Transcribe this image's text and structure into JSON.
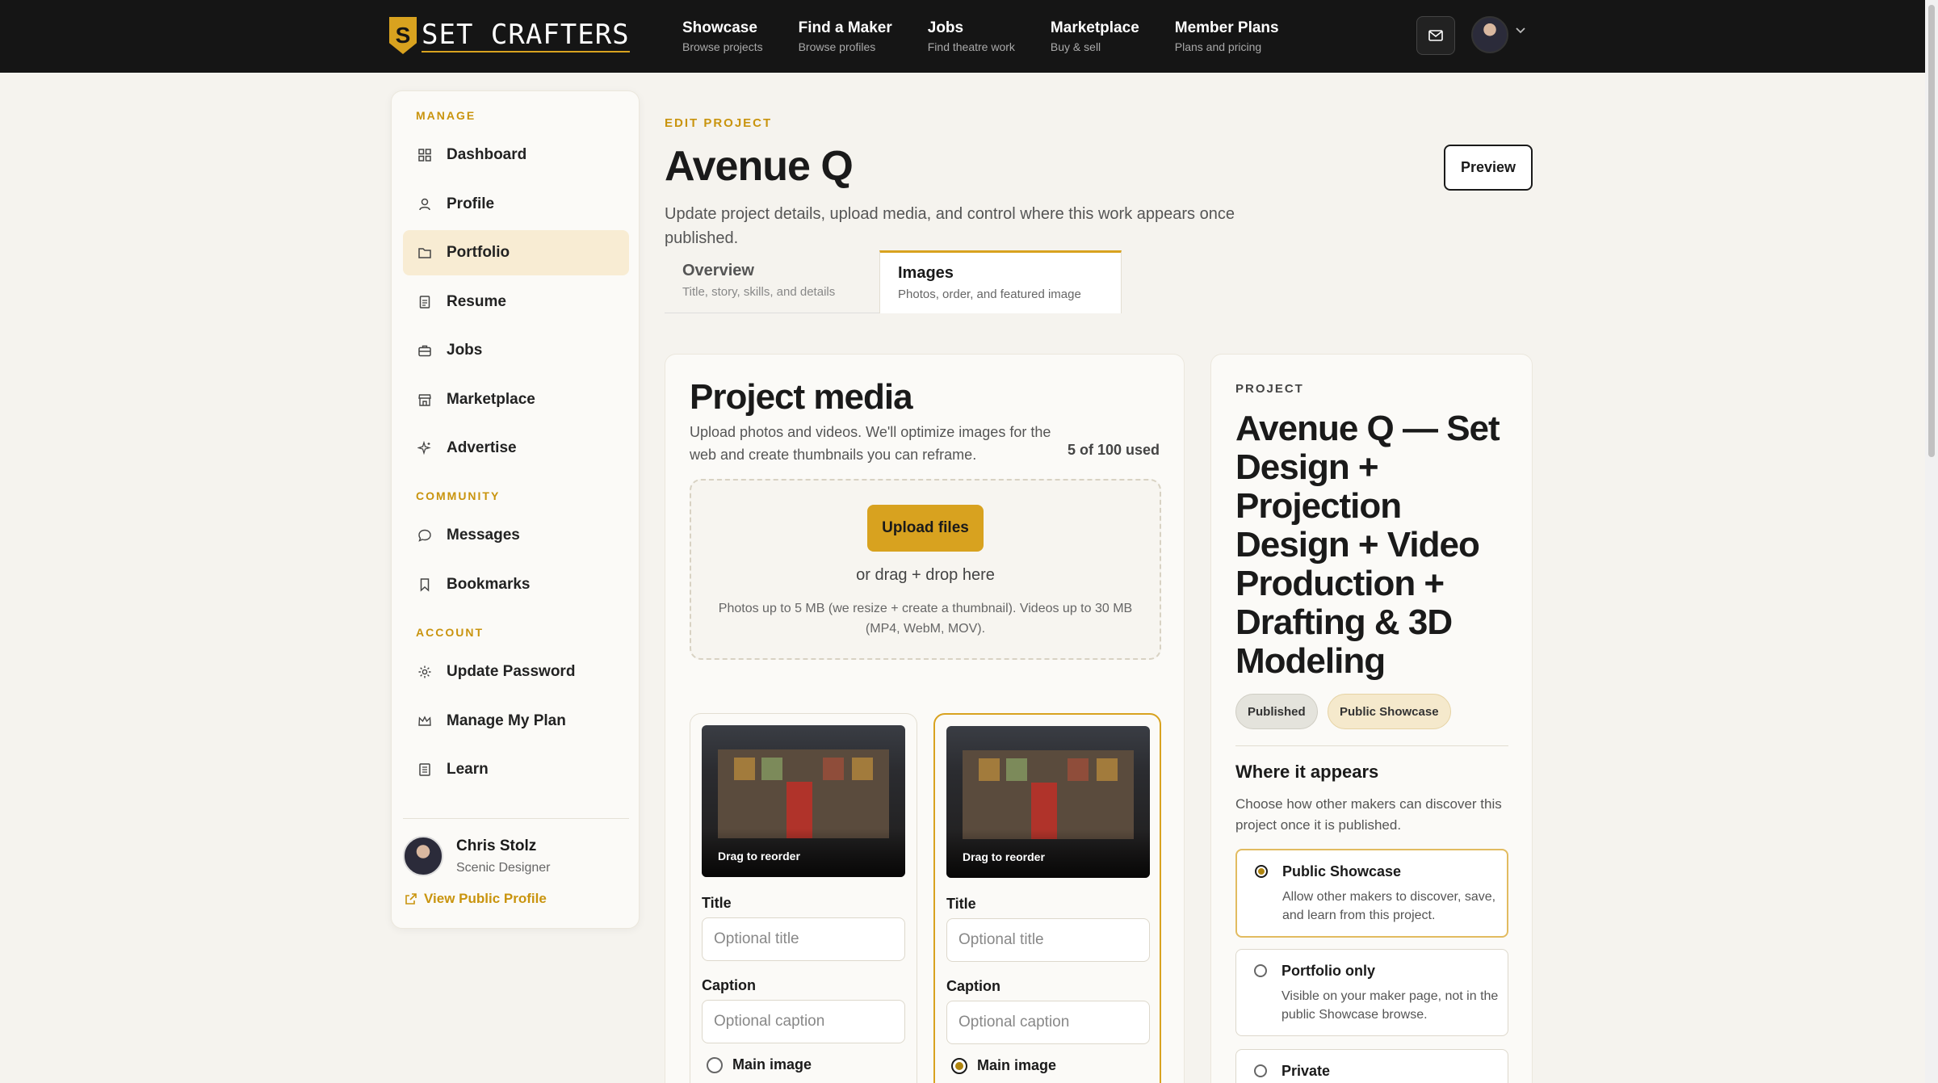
{
  "brand": {
    "name": "SET CRAFTERS",
    "mark": "S"
  },
  "nav": [
    {
      "title": "Showcase",
      "sub": "Browse projects"
    },
    {
      "title": "Find a Maker",
      "sub": "Browse profiles"
    },
    {
      "title": "Jobs",
      "sub": "Find theatre work"
    },
    {
      "title": "Marketplace",
      "sub": "Buy & sell"
    },
    {
      "title": "Member Plans",
      "sub": "Plans and pricing"
    }
  ],
  "topbar": {
    "icons": [
      "mail-icon",
      "chevron-down-icon"
    ]
  },
  "sidebar": {
    "sections": {
      "manage": "MANAGE",
      "community": "COMMUNITY",
      "account": "ACCOUNT"
    },
    "items": [
      {
        "label": "Dashboard",
        "icon": "grid-icon"
      },
      {
        "label": "Profile",
        "icon": "user-icon"
      },
      {
        "label": "Portfolio",
        "icon": "folder-icon",
        "active": true
      },
      {
        "label": "Resume",
        "icon": "document-icon"
      },
      {
        "label": "Jobs",
        "icon": "briefcase-icon"
      },
      {
        "label": "Marketplace",
        "icon": "store-icon"
      },
      {
        "label": "Advertise",
        "icon": "sparkle-icon"
      },
      {
        "label": "Messages",
        "icon": "chat-icon"
      },
      {
        "label": "Bookmarks",
        "icon": "bookmark-icon"
      },
      {
        "label": "Update Password",
        "icon": "gear-icon"
      },
      {
        "label": "Manage My Plan",
        "icon": "crown-icon"
      },
      {
        "label": "Learn",
        "icon": "book-icon"
      }
    ],
    "user": {
      "name": "Chris Stolz",
      "role": "Scenic Designer"
    },
    "public_profile_link": "View Public Profile"
  },
  "header": {
    "eyebrow": "EDIT PROJECT",
    "title": "Avenue Q",
    "description": "Update project details, upload media, and control where this work appears once published.",
    "preview_label": "Preview"
  },
  "tabs": [
    {
      "title": "Overview",
      "sub": "Title, story, skills, and details"
    },
    {
      "title": "Images",
      "sub": "Photos, order, and featured image",
      "active": true
    }
  ],
  "media": {
    "title": "Project media",
    "description": "Upload photos and videos. We'll optimize images for the web and create thumbnails you can reframe.",
    "usage": "5 of 100 used",
    "upload_label": "Upload files",
    "drag_text": "or drag + drop here",
    "limits": "Photos up to 5 MB (we resize + create a thumbnail). Videos up to 30 MB (MP4, WebM, MOV).",
    "items": [
      {
        "drag_label": "Drag to reorder",
        "title_label": "Title",
        "title_placeholder": "Optional title",
        "caption_label": "Caption",
        "caption_placeholder": "Optional caption",
        "main_label": "Main image",
        "main": false
      },
      {
        "drag_label": "Drag to reorder",
        "title_label": "Title",
        "title_placeholder": "Optional title",
        "caption_label": "Caption",
        "caption_placeholder": "Optional caption",
        "main_label": "Main image",
        "main": true
      }
    ]
  },
  "project": {
    "eyebrow": "PROJECT",
    "title": "Avenue Q — Set Design + Projection Design + Video Production + Drafting & 3D Modeling",
    "badges": [
      "Published",
      "Public Showcase"
    ],
    "where_title": "Where it appears",
    "where_desc": "Choose how other makers can discover this project once it is published.",
    "options": [
      {
        "title": "Public Showcase",
        "desc": "Allow other makers to discover, save, and learn from this project.",
        "selected": true
      },
      {
        "title": "Portfolio only",
        "desc": "Visible on your maker page, not in the public Showcase browse.",
        "selected": false
      },
      {
        "title": "Private",
        "desc": "",
        "selected": false
      }
    ]
  },
  "colors": {
    "accent": "#d8a21f",
    "topbar": "#151515",
    "background": "#f5f3ee"
  }
}
